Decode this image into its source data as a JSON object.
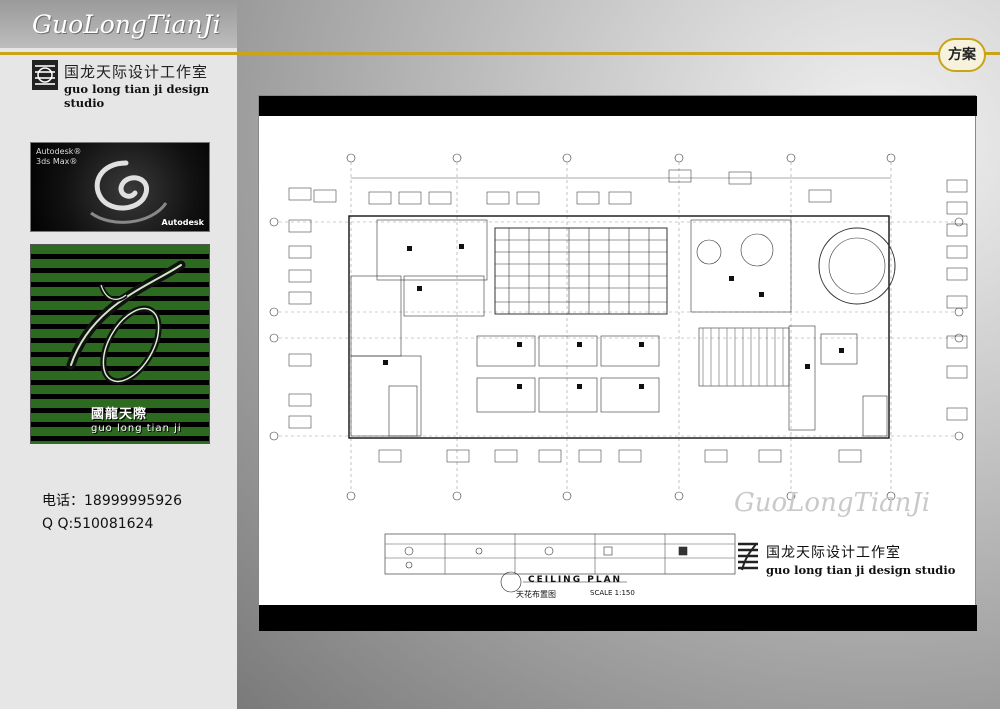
{
  "brand_script": "GuoLongTianJi",
  "studio_name_cn": "国龙天际设计工作室",
  "studio_name_en": "guo long tian ji design studio",
  "badge_label": "方案",
  "autodesk": {
    "title_line1": "Autodesk®",
    "title_line2": "3ds Max®",
    "brand": "Autodesk"
  },
  "logo": {
    "cn": "國龍天際",
    "en": "guo long tian ji"
  },
  "contact": {
    "phone": "电话：18999995926",
    "qq": "Q  Q:510081624"
  },
  "drawing": {
    "title": "CEILING PLAN",
    "title_cn": "天花布置图",
    "scale": "SCALE 1:150"
  },
  "colors": {
    "accent_gold": "#c8a416",
    "logo_green": "#2b6a1f"
  }
}
